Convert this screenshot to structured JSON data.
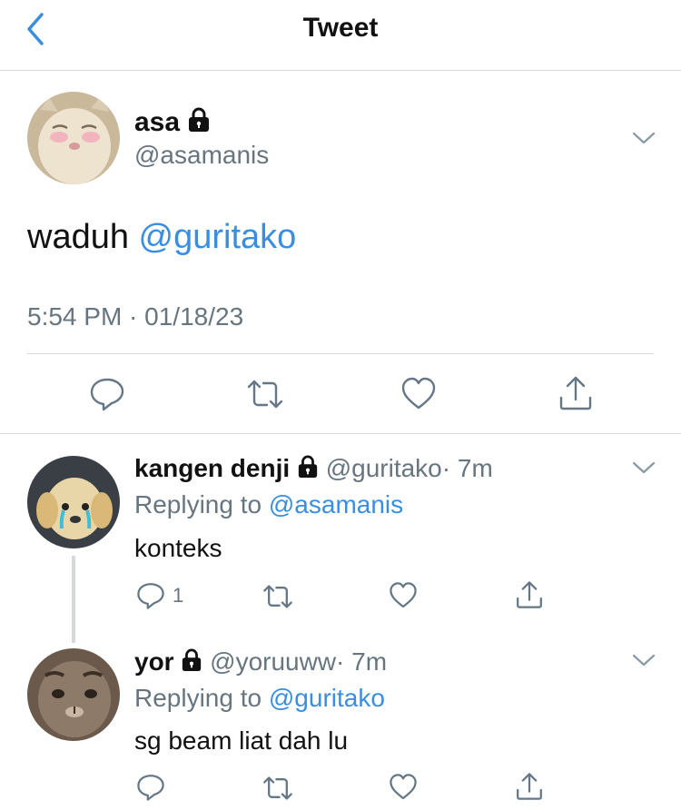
{
  "header": {
    "title": "Tweet"
  },
  "main_tweet": {
    "display_name": "asa",
    "handle": "@asamanis",
    "text": "waduh",
    "mention": "@guritako",
    "timestamp": "5:54 PM · 01/18/23"
  },
  "replies": [
    {
      "display_name": "kangen denji",
      "handle": "@guritako",
      "time": "· 7m",
      "replying_prefix": "Replying to",
      "replying_to": "@asamanis",
      "text": "konteks",
      "reply_count": "1"
    },
    {
      "display_name": "yor",
      "handle": "@yoruuww",
      "time": "· 7m",
      "replying_prefix": "Replying to",
      "replying_to": "@guritako",
      "text": "sg beam liat dah lu"
    }
  ],
  "icons": [
    "back-icon",
    "lock-icon",
    "chevron-down-icon",
    "reply-icon",
    "retweet-icon",
    "like-icon",
    "share-icon"
  ],
  "colors": {
    "accent": "#3a8ee0",
    "secondary_text": "#66757f",
    "divider": "#d5d9dd"
  }
}
